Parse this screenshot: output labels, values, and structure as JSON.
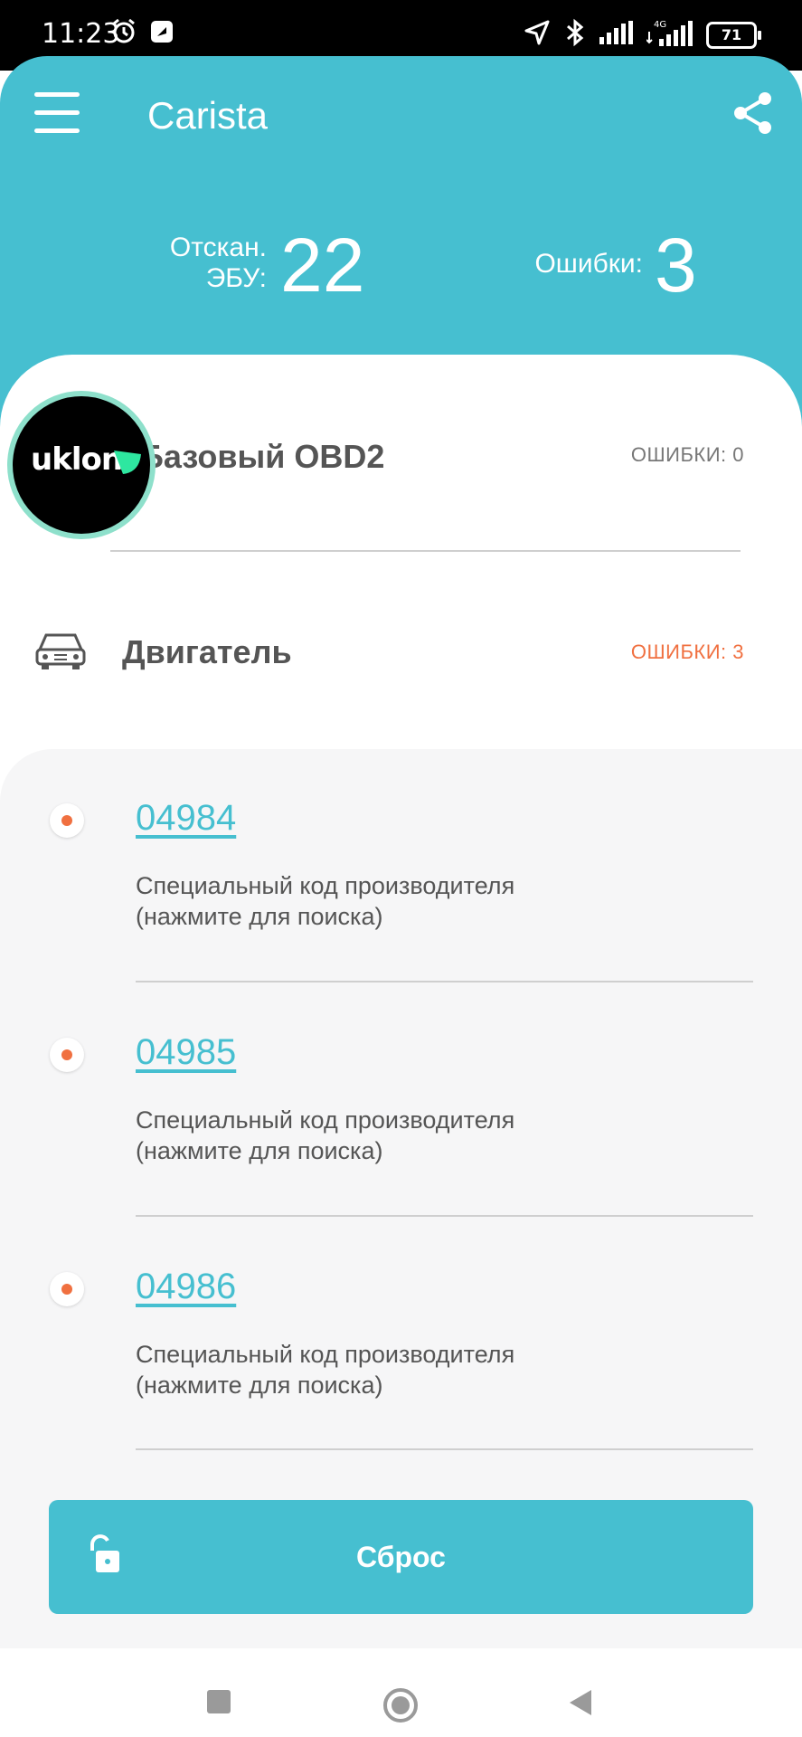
{
  "status_bar": {
    "time": "11:23",
    "battery": "71",
    "icons": [
      "alarm-icon",
      "notification-icon",
      "location-icon",
      "bluetooth-icon",
      "signal-icon",
      "signal-4g-icon",
      "battery-icon"
    ]
  },
  "header": {
    "title": "Carista",
    "scanned_label_line1": "Отскан.",
    "scanned_label_line2": "ЭБУ:",
    "scanned_value": "22",
    "errors_label": "Ошибки:",
    "errors_value": "3",
    "accent_color": "#46bfd0"
  },
  "avatar": {
    "text": "uklon"
  },
  "sections": [
    {
      "title": "Базовый OBD2",
      "errors": "ОШИБКИ: 0",
      "errors_color": "#777777"
    },
    {
      "title": "Двигатель",
      "errors": "ОШИБКИ: 3",
      "errors_color": "#f07040"
    }
  ],
  "error_codes": [
    {
      "code": "04984",
      "desc_line1": "Специальный код производителя",
      "desc_line2": "(нажмите для поиска)"
    },
    {
      "code": "04985",
      "desc_line1": "Специальный код производителя",
      "desc_line2": "(нажмите для поиска)"
    },
    {
      "code": "04986",
      "desc_line1": "Специальный код производителя",
      "desc_line2": "(нажмите для поиска)"
    }
  ],
  "reset_button": {
    "label": "Сброс"
  }
}
